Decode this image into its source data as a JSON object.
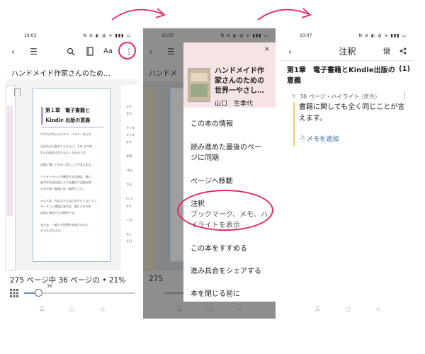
{
  "status": {
    "time1": "10:03",
    "time2": "10:07",
    "time3": "10:07",
    "icons": "N ⊘ ◐ ◍ ᯤ ▮▮▮ ▭"
  },
  "reader": {
    "title": "ハンドメイド作家さんのため…",
    "progress": "275 ページ中 36 ページの • 21%",
    "slider_value": "36",
    "slider_fraction": 0.131,
    "page": {
      "chapter": "第１章　電子書籍と",
      "chapter2": "Kindle 出版の意義",
      "lines": [
        "アナログからデジタル、リスナーから大",
        "",
        "日日の日日変わりとともに、それ まであ",
        "れらの部分はがたまたしまものです。",
        "",
        "出版に関しても全く同じことが言えます。",
        "",
        "インターネットが普及する以前は、数い",
        "あがれれば出点により先進めて出鉱を問",
        "する方法一般的には一般的でした。",
        "",
        "ゃんでは、今はスマホなどのデバイスとイン",
        "ターネット環境はあれば、誰にもかがも ",
        "自由に発信できる時代です。",
        "",
        "まとめ、一般人が世界を交流されるで",
        "せられるれます。"
      ],
      "side_lines": [
        "さそ",
        "ずの",
        "",
        "さてけ",
        "ずです",
        "ます",
        "",
        "学用",
        "",
        ":今日",
        "",
        "で日",
        "",
        "日 ヨ",
        "ます",
        "",
        "ソ日",
        "",
        "ちこ",
        "そ日"
      ]
    }
  },
  "menu": {
    "book_title": "ハンドメイド作家さんのための世界一やさし…",
    "book_title_lines": [
      "ハンドメイド作",
      "家さんのための",
      "世界一やさし…"
    ],
    "author": "山口　生季代",
    "behind_title": "ハンドメ",
    "behind_progress": "275",
    "items": [
      {
        "label": "この本の情報"
      },
      {
        "label": "読み進めた最後のペー",
        "label2": "ジに同期"
      },
      {
        "label": "ページへ移動"
      },
      {
        "label": "注釈",
        "sub": "ブックマーク、メモ、ハ",
        "sub2": "イライトを表示"
      },
      {
        "label": "この本をすすめる"
      },
      {
        "label": "進み具合をシェアする"
      },
      {
        "label": "本を閉じる前に"
      }
    ]
  },
  "notes": {
    "header": "注釈",
    "chapter": "第1章　電子書籍とKindle出版の",
    "chapter2": "意義",
    "count": "(1)",
    "meta": "36 ページ・ハイライト",
    "color_label": "(黄色)",
    "quote": "書籍に関しても全く同じことが言",
    "quote2": "えます。",
    "add_memo": "メモを追加"
  },
  "colors": {
    "accent": "#e8265e",
    "highlight": "#f4d34b",
    "link": "#2a6aa8",
    "chapter_bar": "#b39ddb"
  }
}
